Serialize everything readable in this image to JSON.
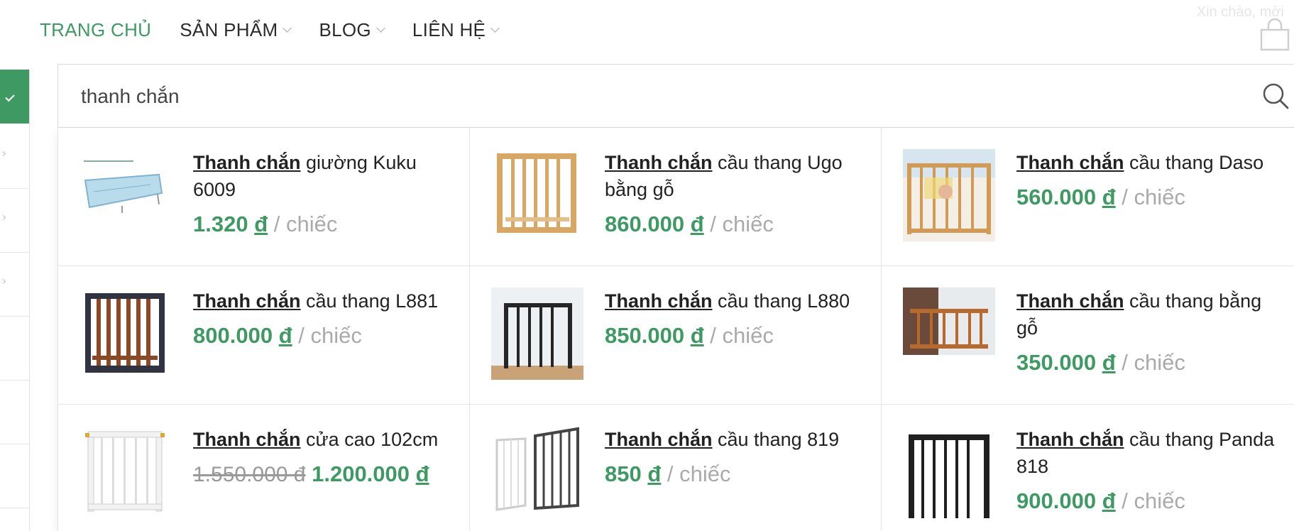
{
  "nav": {
    "items": [
      {
        "label": "TRANG CHỦ",
        "active": true,
        "has_dropdown": false
      },
      {
        "label": "SẢN PHẨM",
        "active": false,
        "has_dropdown": true
      },
      {
        "label": "BLOG",
        "active": false,
        "has_dropdown": true
      },
      {
        "label": "LIÊN HỆ",
        "active": false,
        "has_dropdown": true
      }
    ],
    "greeting": "Xin chào, mời"
  },
  "search": {
    "value": "thanh chắn",
    "icon": "search-icon"
  },
  "results": [
    {
      "highlight": "Thanh chắn",
      "rest": " giường Kuku 6009",
      "old_price": "",
      "price": "1.320",
      "currency": "đ",
      "unit": " / chiếc"
    },
    {
      "highlight": "Thanh chắn",
      "rest": " cầu thang Ugo bằng gỗ",
      "old_price": "",
      "price": "860.000",
      "currency": "đ",
      "unit": " / chiếc"
    },
    {
      "highlight": "Thanh chắn",
      "rest": " cầu thang Daso",
      "old_price": "",
      "price": "560.000",
      "currency": "đ",
      "unit": " / chiếc"
    },
    {
      "highlight": "Thanh chắn",
      "rest": " cầu thang L881",
      "old_price": "",
      "price": "800.000",
      "currency": "đ",
      "unit": " / chiếc"
    },
    {
      "highlight": "Thanh chắn",
      "rest": " cầu thang L880",
      "old_price": "",
      "price": "850.000",
      "currency": "đ",
      "unit": " / chiếc"
    },
    {
      "highlight": "Thanh chắn",
      "rest": " cầu thang bằng gỗ",
      "old_price": "",
      "price": "350.000",
      "currency": "đ",
      "unit": " / chiếc"
    },
    {
      "highlight": "Thanh chắn",
      "rest": " cửa cao 102cm",
      "old_price": "1.550.000 đ",
      "price": "1.200.000",
      "currency": "đ",
      "unit": ""
    },
    {
      "highlight": "Thanh chắn",
      "rest": " cầu thang 819",
      "old_price": "",
      "price": "850",
      "currency": "đ",
      "unit": " / chiếc"
    },
    {
      "highlight": "Thanh chắn",
      "rest": " cầu thang Panda 818",
      "old_price": "",
      "price": "900.000",
      "currency": "đ",
      "unit": " / chiếc"
    }
  ],
  "colors": {
    "accent": "#3e9a62",
    "muted": "#aaaaaa"
  }
}
